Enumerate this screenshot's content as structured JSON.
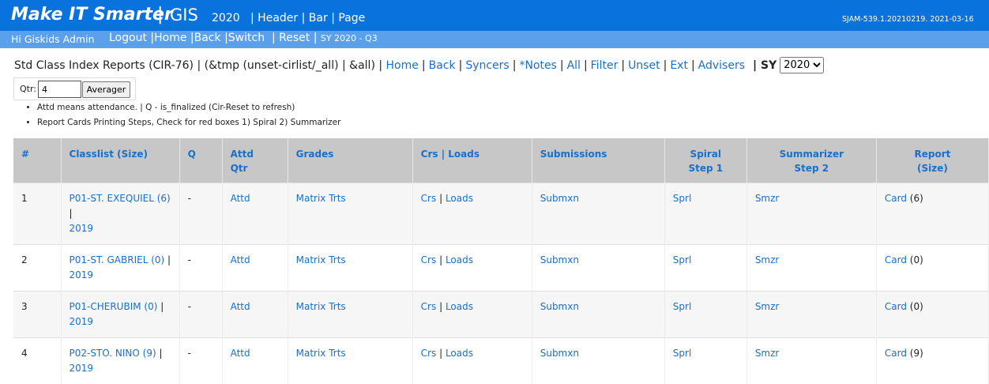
{
  "header": {
    "brand": "Make IT Smarter",
    "separator": "|",
    "gis": "GIS",
    "year": "2020",
    "links": [
      "Header",
      "Bar",
      "Page"
    ],
    "version": "SJAM-539.1.20210219. 2021-03-16"
  },
  "subbar": {
    "greeting": "Hi Giskids Admin",
    "links": [
      "Logout",
      "Home",
      "Back",
      "Switch"
    ],
    "reset": "Reset",
    "sy_tag": "SY 2020 - Q3"
  },
  "report": {
    "title": "Std Class Index Reports (CIR-76) | (&tmp (unset-cirlist/_all) | &all) |",
    "links": [
      "Home",
      "Back",
      "Syncers",
      "*Notes",
      "All",
      "Filter",
      "Unset",
      "Ext",
      "Advisers"
    ],
    "sy_label": "| SY",
    "sy_value": "2020"
  },
  "qtr": {
    "label": "Qtr:",
    "value": "4",
    "button": "Averager"
  },
  "notes": [
    "Attd means attendance. | Q - is_finalized (Cir-Reset to refresh)",
    "Report Cards Printing Steps, Check for red boxes 1) Spiral 2) Summarizer"
  ],
  "table": {
    "headers": {
      "num": "#",
      "classlist": "Classlist (Size)",
      "q": "Q",
      "attd_1": "Attd",
      "attd_2": "Qtr",
      "grades": "Grades",
      "crs_loads": "Crs | Loads",
      "submissions": "Submissions",
      "spiral_1": "Spiral",
      "spiral_2": "Step 1",
      "summ_1": "Summarizer",
      "summ_2": "Step 2",
      "report_1": "Report",
      "report_2": "(Size)"
    },
    "rows": [
      {
        "num": "1",
        "classlist": "P01-ST. EXEQUIEL (6)",
        "year": "2019",
        "q": "-",
        "attd": "Attd",
        "grades": "Matrix Trts",
        "crs": "Crs",
        "loads": "Loads",
        "submissions": "Submxn",
        "spiral": "Sprl",
        "summarizer": "Smzr",
        "card": "Card",
        "size": "(6)"
      },
      {
        "num": "2",
        "classlist": "P01-ST. GABRIEL (0)",
        "year": "2019",
        "q": "-",
        "attd": "Attd",
        "grades": "Matrix Trts",
        "crs": "Crs",
        "loads": "Loads",
        "submissions": "Submxn",
        "spiral": "Sprl",
        "summarizer": "Smzr",
        "card": "Card",
        "size": "(0)"
      },
      {
        "num": "3",
        "classlist": "P01-CHERUBIM (0)",
        "year": "2019",
        "q": "-",
        "attd": "Attd",
        "grades": "Matrix Trts",
        "crs": "Crs",
        "loads": "Loads",
        "submissions": "Submxn",
        "spiral": "Sprl",
        "summarizer": "Smzr",
        "card": "Card",
        "size": "(0)"
      },
      {
        "num": "4",
        "classlist": "P02-STO. NINO (9)",
        "year": "2019",
        "q": "-",
        "attd": "Attd",
        "grades": "Matrix Trts",
        "crs": "Crs",
        "loads": "Loads",
        "submissions": "Submxn",
        "spiral": "Sprl",
        "summarizer": "Smzr",
        "card": "Card",
        "size": "(9)"
      }
    ]
  }
}
